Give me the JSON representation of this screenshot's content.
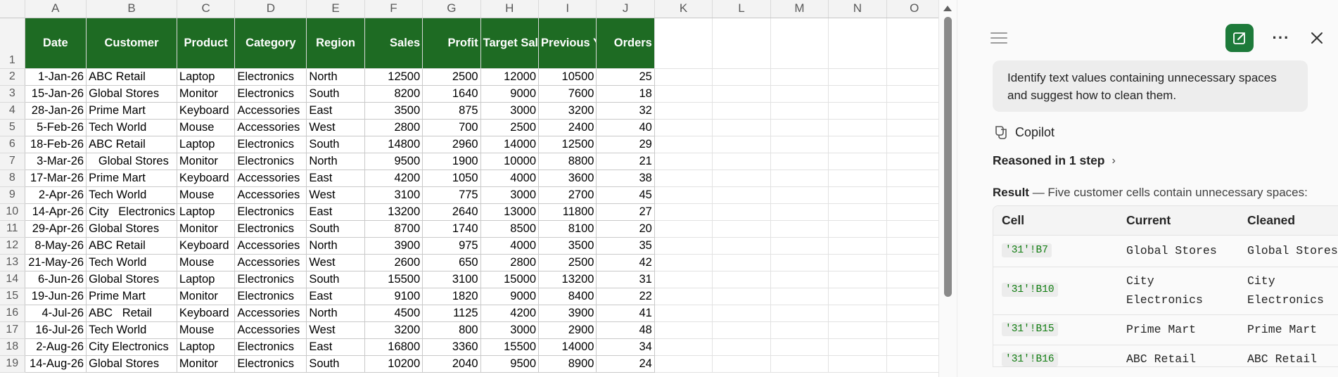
{
  "sheet": {
    "columns": [
      "A",
      "B",
      "C",
      "D",
      "E",
      "F",
      "G",
      "H",
      "I",
      "J",
      "K",
      "L",
      "M",
      "N",
      "O"
    ],
    "header_row_number": "1",
    "headers": {
      "date": "Date",
      "customer": "Customer",
      "product": "Product",
      "category": "Category",
      "region": "Region",
      "sales": "Sales",
      "profit": "Profit",
      "target_sales": "Target Sales",
      "previous_year_sales": "Previous Year Sales",
      "orders": "Orders"
    },
    "rows": [
      {
        "n": "2",
        "date": "1-Jan-26",
        "customer": "ABC Retail",
        "product": "Laptop",
        "category": "Electronics",
        "region": "North",
        "sales": "12500",
        "profit": "2500",
        "target": "12000",
        "prev": "10500",
        "orders": "25"
      },
      {
        "n": "3",
        "date": "15-Jan-26",
        "customer": "Global Stores",
        "product": "Monitor",
        "category": "Electronics",
        "region": "South",
        "sales": "8200",
        "profit": "1640",
        "target": "9000",
        "prev": "7600",
        "orders": "18"
      },
      {
        "n": "4",
        "date": "28-Jan-26",
        "customer": "Prime Mart",
        "product": "Keyboard",
        "category": "Accessories",
        "region": "East",
        "sales": "3500",
        "profit": "875",
        "target": "3000",
        "prev": "3200",
        "orders": "32"
      },
      {
        "n": "5",
        "date": "5-Feb-26",
        "customer": "Tech World",
        "product": "Mouse",
        "category": "Accessories",
        "region": "West",
        "sales": "2800",
        "profit": "700",
        "target": "2500",
        "prev": "2400",
        "orders": "40"
      },
      {
        "n": "6",
        "date": "18-Feb-26",
        "customer": "ABC Retail",
        "product": "Laptop",
        "category": "Electronics",
        "region": "South",
        "sales": "14800",
        "profit": "2960",
        "target": "14000",
        "prev": "12500",
        "orders": "29"
      },
      {
        "n": "7",
        "date": "3-Mar-26",
        "customer": "   Global Stores",
        "product": "Monitor",
        "category": "Electronics",
        "region": "North",
        "sales": "9500",
        "profit": "1900",
        "target": "10000",
        "prev": "8800",
        "orders": "21"
      },
      {
        "n": "8",
        "date": "17-Mar-26",
        "customer": "Prime Mart",
        "product": "Keyboard",
        "category": "Accessories",
        "region": "East",
        "sales": "4200",
        "profit": "1050",
        "target": "4000",
        "prev": "3600",
        "orders": "38"
      },
      {
        "n": "9",
        "date": "2-Apr-26",
        "customer": "Tech World",
        "product": "Mouse",
        "category": "Accessories",
        "region": "West",
        "sales": "3100",
        "profit": "775",
        "target": "3000",
        "prev": "2700",
        "orders": "45"
      },
      {
        "n": "10",
        "date": "14-Apr-26",
        "customer": "City   Electronics",
        "product": "Laptop",
        "category": "Electronics",
        "region": "East",
        "sales": "13200",
        "profit": "2640",
        "target": "13000",
        "prev": "11800",
        "orders": "27"
      },
      {
        "n": "11",
        "date": "29-Apr-26",
        "customer": "Global Stores",
        "product": "Monitor",
        "category": "Electronics",
        "region": "South",
        "sales": "8700",
        "profit": "1740",
        "target": "8500",
        "prev": "8100",
        "orders": "20"
      },
      {
        "n": "12",
        "date": "8-May-26",
        "customer": "ABC Retail",
        "product": "Keyboard",
        "category": "Accessories",
        "region": "North",
        "sales": "3900",
        "profit": "975",
        "target": "4000",
        "prev": "3500",
        "orders": "35"
      },
      {
        "n": "13",
        "date": "21-May-26",
        "customer": "Tech World",
        "product": "Mouse",
        "category": "Accessories",
        "region": "West",
        "sales": "2600",
        "profit": "650",
        "target": "2800",
        "prev": "2500",
        "orders": "42"
      },
      {
        "n": "14",
        "date": "6-Jun-26",
        "customer": "Global Stores",
        "product": "Laptop",
        "category": "Electronics",
        "region": "South",
        "sales": "15500",
        "profit": "3100",
        "target": "15000",
        "prev": "13200",
        "orders": "31"
      },
      {
        "n": "15",
        "date": "19-Jun-26",
        "customer": "Prime Mart",
        "product": "Monitor",
        "category": "Electronics",
        "region": "East",
        "sales": "9100",
        "profit": "1820",
        "target": "9000",
        "prev": "8400",
        "orders": "22"
      },
      {
        "n": "16",
        "date": "4-Jul-26",
        "customer": "ABC   Retail",
        "product": "Keyboard",
        "category": "Accessories",
        "region": "North",
        "sales": "4500",
        "profit": "1125",
        "target": "4200",
        "prev": "3900",
        "orders": "41"
      },
      {
        "n": "17",
        "date": "16-Jul-26",
        "customer": "Tech World",
        "product": "Mouse",
        "category": "Accessories",
        "region": "West",
        "sales": "3200",
        "profit": "800",
        "target": "3000",
        "prev": "2900",
        "orders": "48"
      },
      {
        "n": "18",
        "date": "2-Aug-26",
        "customer": "City Electronics",
        "product": "Laptop",
        "category": "Electronics",
        "region": "East",
        "sales": "16800",
        "profit": "3360",
        "target": "15500",
        "prev": "14000",
        "orders": "34"
      },
      {
        "n": "19",
        "date": "14-Aug-26",
        "customer": "Global Stores",
        "product": "Monitor",
        "category": "Electronics",
        "region": "South",
        "sales": "10200",
        "profit": "2040",
        "target": "9500",
        "prev": "8900",
        "orders": "24"
      }
    ]
  },
  "copilot": {
    "prompt": "Identify text values containing unnecessary spaces and suggest how to clean them.",
    "name": "Copilot",
    "reasoned": "Reasoned in 1 step",
    "result_label": "Result",
    "result_text": " — Five customer cells contain unnecessary spaces:",
    "table": {
      "headers": [
        "Cell",
        "Current",
        "Cleaned"
      ],
      "rows": [
        {
          "cell": "'31'!B7",
          "current": "Global Stores",
          "cleaned": "Global Stores"
        },
        {
          "cell": "'31'!B10",
          "current": "City\nElectronics",
          "cleaned": "City\nElectronics"
        },
        {
          "cell": "'31'!B15",
          "current": "Prime Mart",
          "cleaned": "Prime Mart"
        },
        {
          "cell": "'31'!B16",
          "current": "ABC Retail",
          "cleaned": "ABC Retail"
        }
      ]
    },
    "icons": {
      "menu": "menu-icon",
      "new_chat": "compose-icon",
      "more": "more-icon",
      "close": "close-icon",
      "copilot": "copilot-icon",
      "chevron": "chevron-right-icon"
    },
    "accent": "#1d7a3a"
  }
}
